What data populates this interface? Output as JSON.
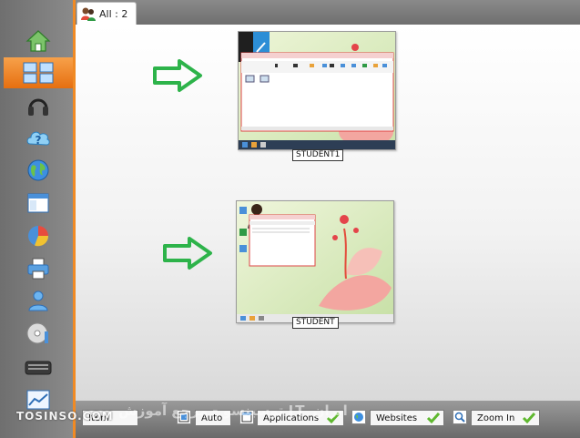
{
  "tab": {
    "label": "All : 2",
    "icon": "users-icon"
  },
  "sidebar": {
    "items": [
      {
        "name": "home-icon"
      },
      {
        "name": "thumbnails-icon",
        "active": true
      },
      {
        "name": "headphones-icon"
      },
      {
        "name": "help-icon"
      },
      {
        "name": "globe-icon"
      },
      {
        "name": "window-icon"
      },
      {
        "name": "pie-chart-icon"
      },
      {
        "name": "printer-icon"
      },
      {
        "name": "user-icon"
      },
      {
        "name": "cd-icon"
      },
      {
        "name": "keyboard-icon"
      },
      {
        "name": "chart-icon"
      }
    ]
  },
  "clients": [
    {
      "label": "STUDENT1"
    },
    {
      "label": "STUDENT"
    }
  ],
  "toolbar": {
    "item1": "Item",
    "auto": "Auto",
    "applications": "Applications",
    "websites": "Websites",
    "zoom_in": "Zoom In"
  },
  "watermark": "TOSINSO.COM",
  "watermark_ar": "توسینسو - مرجع آموزش IT ایران",
  "colors": {
    "accent": "#f08a24",
    "arrow": "#2db34a"
  }
}
